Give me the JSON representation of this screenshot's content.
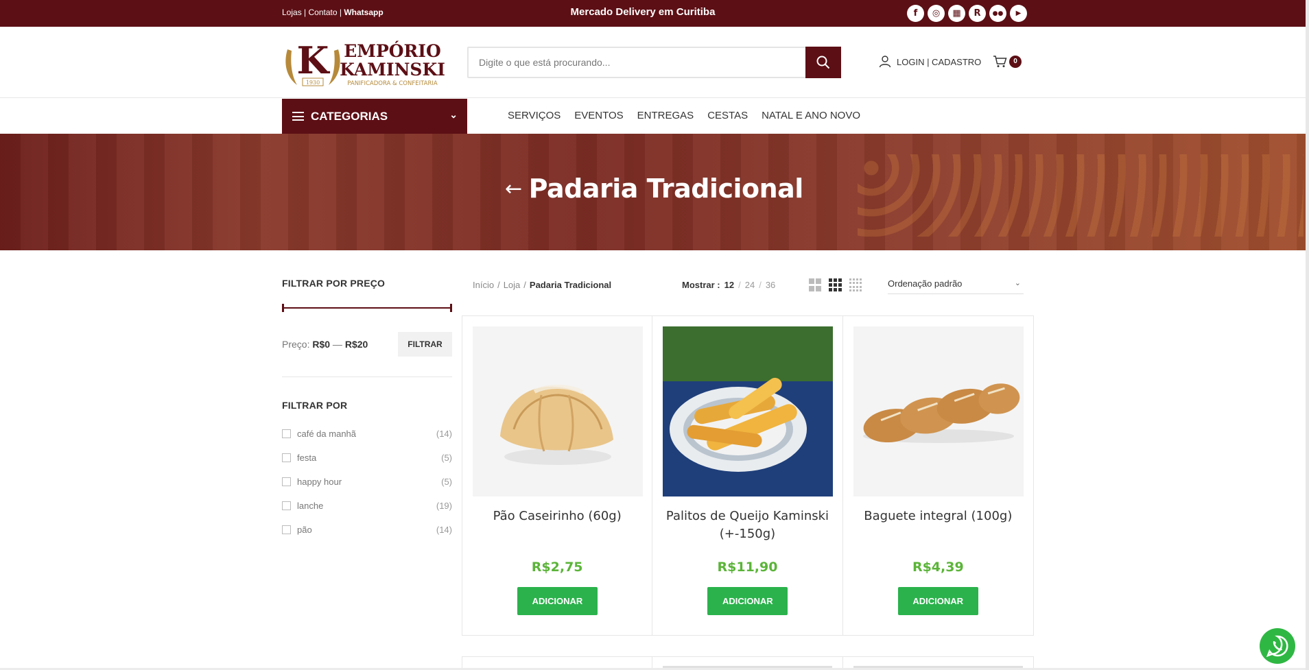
{
  "topbar": {
    "links": [
      "Lojas",
      "Contato",
      "Whatsapp"
    ],
    "separator": " | ",
    "announcement": "Mercado Delivery em Curitiba",
    "socials": [
      {
        "name": "facebook-icon",
        "glyph": "f"
      },
      {
        "name": "instagram-icon",
        "glyph": "◎"
      },
      {
        "name": "store-icon",
        "glyph": "▦"
      },
      {
        "name": "rappi-icon",
        "glyph": "R"
      },
      {
        "name": "tripadvisor-icon",
        "glyph": "●●"
      },
      {
        "name": "youtube-icon",
        "glyph": "▶"
      }
    ]
  },
  "header": {
    "logo": {
      "brand_line1": "EMPÓRIO",
      "brand_line2": "KAMINSKI",
      "tagline": "PANIFICADORA & CONFEITARIA",
      "year": "1930",
      "letter": "K"
    },
    "search_placeholder": "Digite o que está procurando...",
    "login_label": "LOGIN | CADASTRO",
    "cart_count": "0"
  },
  "nav": {
    "categories_label": "CATEGORIAS",
    "menu": [
      "SERVIÇOS",
      "EVENTOS",
      "ENTREGAS",
      "CESTAS",
      "NATAL E ANO NOVO"
    ]
  },
  "hero": {
    "title": "Padaria Tradicional",
    "back_arrow": "←"
  },
  "sidebar": {
    "price_filter_title": "FILTRAR POR PREÇO",
    "price_label": "Preço:",
    "price_min": "R$0",
    "price_dash": " — ",
    "price_max": "R$20",
    "filter_button": "FILTRAR",
    "filter_by_title": "FILTRAR POR",
    "filters": [
      {
        "label": "café da manhã",
        "count": "(14)"
      },
      {
        "label": "festa",
        "count": "(5)"
      },
      {
        "label": "happy hour",
        "count": "(5)"
      },
      {
        "label": "lanche",
        "count": "(19)"
      },
      {
        "label": "pão",
        "count": "(14)"
      }
    ]
  },
  "toolbar": {
    "breadcrumb": [
      "Início",
      "Loja",
      "Padaria Tradicional"
    ],
    "show_label": "Mostrar :",
    "show_options": [
      "12",
      "24",
      "36"
    ],
    "show_selected": "12",
    "sort_selected": "Ordenação padrão"
  },
  "products": [
    {
      "title": "Pão Caseirinho (60g)",
      "price": "R$2,75",
      "button": "ADICIONAR"
    },
    {
      "title": "Palitos de Queijo Kaminski (+-150g)",
      "price": "R$11,90",
      "button": "ADICIONAR"
    },
    {
      "title": "Baguete integral (100g)",
      "price": "R$4,39",
      "button": "ADICIONAR"
    }
  ],
  "colors": {
    "brand": "#5c0f15",
    "price": "#5bb439",
    "button": "#2bb24c",
    "logo_gold": "#b68a3a"
  }
}
